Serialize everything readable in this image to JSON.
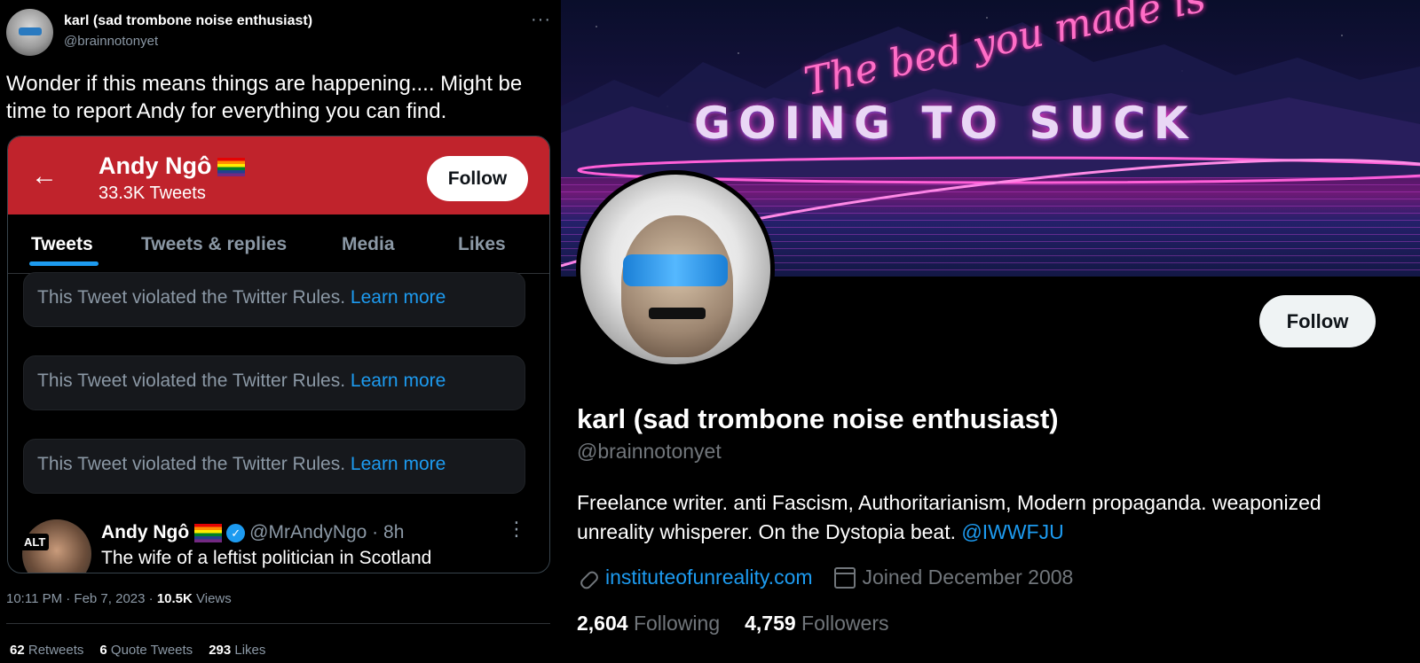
{
  "tweet": {
    "author_name": "karl (sad trombone noise enthusiast)",
    "author_handle": "@brainnotonyet",
    "more_icon": "more-horizontal-icon",
    "text": "Wonder if this means things are happening.... Might be time to report Andy for everything you can find.",
    "timestamp": "10:11 PM · Feb 7, 2023 · ",
    "views_count": "10.5K",
    "views_label": " Views",
    "retweets_count": "62",
    "retweets_label": " Retweets",
    "quote_count": "6",
    "quote_label": " Quote Tweets",
    "likes_count": "293",
    "likes_label": " Likes"
  },
  "embedded": {
    "back_icon": "arrow-left-icon",
    "profile_name": "Andy Ngô",
    "tweet_count": "33.3K Tweets",
    "follow_label": "Follow",
    "tabs": [
      {
        "label": "Tweets",
        "active": true
      },
      {
        "label": "Tweets & replies",
        "active": false
      },
      {
        "label": "Media",
        "active": false
      },
      {
        "label": "Likes",
        "active": false
      }
    ],
    "violations": [
      {
        "text": "This Tweet violated the Twitter Rules.",
        "link": "Learn more"
      },
      {
        "text": "This Tweet violated the Twitter Rules.",
        "link": "Learn more"
      },
      {
        "text": "This Tweet violated the Twitter Rules.",
        "link": "Learn more"
      }
    ],
    "post": {
      "alt_badge": "ALT",
      "name": "Andy Ngô",
      "handle_time": "@MrAndyNgo · 8h",
      "text": "The wife of a leftist politician in Scotland"
    }
  },
  "profile": {
    "banner_script": "The bed you made is",
    "banner_headline": "GOING TO SUCK",
    "follow_label": "Follow",
    "name": "karl (sad trombone noise enthusiast)",
    "handle": "@brainnotonyet",
    "bio": "Freelance writer. anti Fascism, Authoritarianism, Modern propaganda. weaponized unreality whisperer. On the Dystopia beat. ",
    "bio_mention": "@IWWFJU",
    "website": "instituteofunreality.com",
    "joined": "Joined December 2008",
    "following_count": "2,604",
    "following_label": " Following",
    "followers_count": "4,759",
    "followers_label": " Followers"
  },
  "colors": {
    "accent": "#1d9bf0",
    "header_red": "#c0232c",
    "muted_text": "#71767b"
  }
}
